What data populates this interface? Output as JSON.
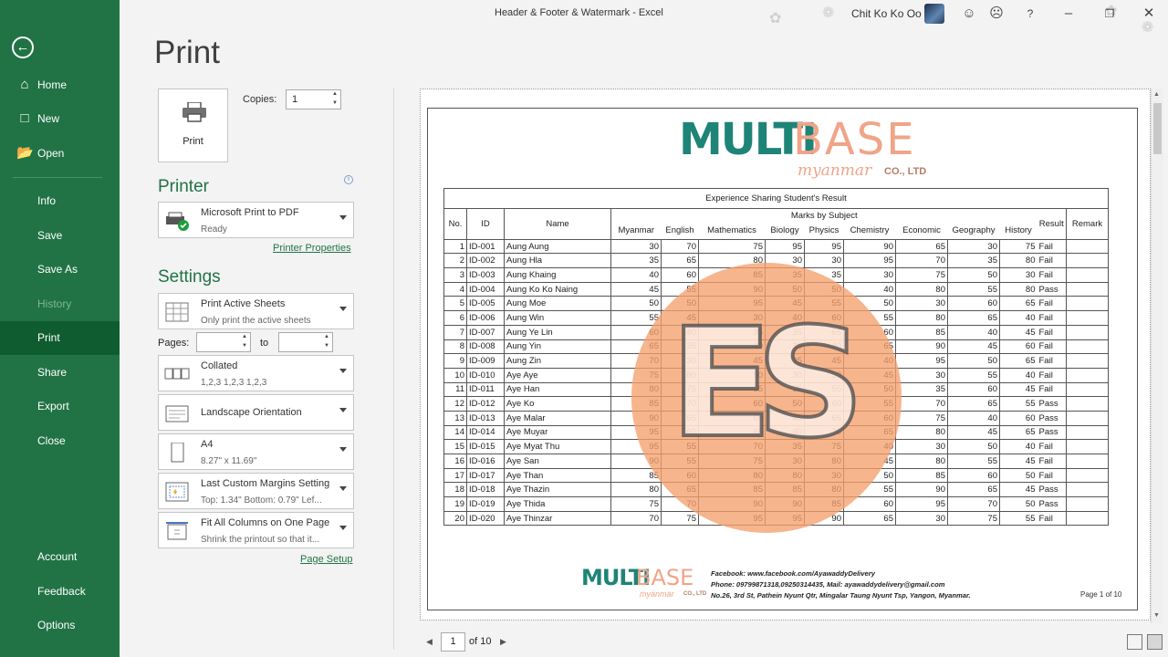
{
  "window": {
    "title": "Header & Footer & Watermark  -  Excel",
    "user": "Chit Ko Ko Oo"
  },
  "sidebar": {
    "items": [
      {
        "label": "Home",
        "icon": "home-icon"
      },
      {
        "label": "New",
        "icon": "new-document-icon"
      },
      {
        "label": "Open",
        "icon": "open-folder-icon"
      },
      {
        "label": "Info"
      },
      {
        "label": "Save"
      },
      {
        "label": "Save As"
      },
      {
        "label": "History"
      },
      {
        "label": "Print"
      },
      {
        "label": "Share"
      },
      {
        "label": "Export"
      },
      {
        "label": "Close"
      },
      {
        "label": "Account"
      },
      {
        "label": "Feedback"
      },
      {
        "label": "Options"
      }
    ]
  },
  "print": {
    "heading": "Print",
    "button_label": "Print",
    "copies_label": "Copies:",
    "copies_value": "1",
    "printer_heading": "Printer",
    "printer_name": "Microsoft Print to PDF",
    "printer_status": "Ready",
    "printer_properties": "Printer Properties",
    "settings_heading": "Settings",
    "sheets_l1": "Print Active Sheets",
    "sheets_l2": "Only print the active sheets",
    "pages_label": "Pages:",
    "to_label": "to",
    "collated_l1": "Collated",
    "collated_l2": "1,2,3    1,2,3    1,2,3",
    "orientation": "Landscape Orientation",
    "paper_l1": "A4",
    "paper_l2": "8.27\" x 11.69\"",
    "margins_l1": "Last Custom Margins Setting",
    "margins_l2": "Top: 1.34\" Bottom: 0.79\" Lef...",
    "scaling_l1": "Fit All Columns on One Page",
    "scaling_l2": "Shrink the printout so that it...",
    "page_setup": "Page Setup"
  },
  "preview": {
    "logo_multi": "MULTI",
    "logo_base": "BASE",
    "logo_myanmar": "myanmar",
    "logo_co": "CO., LTD",
    "table_title": "Experience Sharing Student's Result",
    "headers": {
      "no": "No.",
      "id": "ID",
      "name": "Name",
      "marks": "Marks by Subject",
      "result": "Result",
      "remark": "Remark"
    },
    "subjects": [
      "Myanmar",
      "English",
      "Mathematics",
      "Biology",
      "Physics",
      "Chemistry",
      "Economic",
      "Geography",
      "History"
    ],
    "rows": [
      [
        "1",
        "ID-001",
        "Aung Aung",
        "30",
        "70",
        "75",
        "95",
        "95",
        "90",
        "65",
        "30",
        "75",
        "Fail"
      ],
      [
        "2",
        "ID-002",
        "Aung Hla",
        "35",
        "65",
        "80",
        "30",
        "30",
        "95",
        "70",
        "35",
        "80",
        "Fail"
      ],
      [
        "3",
        "ID-003",
        "Aung Khaing",
        "40",
        "60",
        "85",
        "35",
        "35",
        "30",
        "75",
        "50",
        "30",
        "Fail"
      ],
      [
        "4",
        "ID-004",
        "Aung Ko Ko Naing",
        "45",
        "55",
        "90",
        "50",
        "50",
        "40",
        "80",
        "55",
        "80",
        "Pass"
      ],
      [
        "5",
        "ID-005",
        "Aung Moe",
        "50",
        "50",
        "95",
        "45",
        "55",
        "50",
        "30",
        "60",
        "65",
        "Fail"
      ],
      [
        "6",
        "ID-006",
        "Aung Win",
        "55",
        "45",
        "30",
        "40",
        "60",
        "55",
        "80",
        "65",
        "40",
        "Fail"
      ],
      [
        "7",
        "ID-007",
        "Aung Ye Lin",
        "60",
        "40",
        "35",
        "35",
        "65",
        "60",
        "85",
        "40",
        "45",
        "Fail"
      ],
      [
        "8",
        "ID-008",
        "Aung Yin",
        "65",
        "35",
        "40",
        "30",
        "40",
        "65",
        "90",
        "45",
        "60",
        "Fail"
      ],
      [
        "9",
        "ID-009",
        "Aung Zin",
        "70",
        "30",
        "45",
        "95",
        "45",
        "40",
        "95",
        "50",
        "65",
        "Fail"
      ],
      [
        "10",
        "ID-010",
        "Aye Aye",
        "75",
        "80",
        "50",
        "30",
        "50",
        "45",
        "30",
        "55",
        "40",
        "Fail"
      ],
      [
        "11",
        "ID-011",
        "Aye Han",
        "80",
        "75",
        "55",
        "35",
        "55",
        "50",
        "35",
        "60",
        "45",
        "Fail"
      ],
      [
        "12",
        "ID-012",
        "Aye Ko",
        "85",
        "70",
        "60",
        "50",
        "60",
        "55",
        "70",
        "65",
        "55",
        "Pass"
      ],
      [
        "13",
        "ID-013",
        "Aye Malar",
        "90",
        "65",
        "60",
        "45",
        "65",
        "60",
        "75",
        "40",
        "60",
        "Pass"
      ],
      [
        "14",
        "ID-014",
        "Aye Muyar",
        "95",
        "60",
        "65",
        "40",
        "70",
        "65",
        "80",
        "45",
        "65",
        "Pass"
      ],
      [
        "15",
        "ID-015",
        "Aye Myat Thu",
        "95",
        "55",
        "70",
        "35",
        "75",
        "40",
        "30",
        "50",
        "40",
        "Fail"
      ],
      [
        "16",
        "ID-016",
        "Aye San",
        "90",
        "55",
        "75",
        "30",
        "80",
        "45",
        "80",
        "55",
        "45",
        "Fail"
      ],
      [
        "17",
        "ID-017",
        "Aye Than",
        "85",
        "60",
        "80",
        "80",
        "30",
        "50",
        "85",
        "60",
        "50",
        "Fail"
      ],
      [
        "18",
        "ID-018",
        "Aye Thazin",
        "80",
        "65",
        "85",
        "85",
        "80",
        "55",
        "90",
        "65",
        "45",
        "Pass"
      ],
      [
        "19",
        "ID-019",
        "Aye Thida",
        "75",
        "70",
        "90",
        "90",
        "85",
        "60",
        "95",
        "70",
        "50",
        "Pass"
      ],
      [
        "20",
        "ID-020",
        "Aye Thinzar",
        "70",
        "75",
        "95",
        "95",
        "90",
        "65",
        "30",
        "75",
        "55",
        "Fail"
      ]
    ],
    "watermark": "ES",
    "footer": {
      "facebook": "Facebook: www.facebook.com/AyawaddyDelivery",
      "phone": "Phone: 09799871318,09250314435, Mail: ayawaddydelivery@gmail.com",
      "address": "No.26, 3rd St, Pathein Nyunt Qtr, Mingalar Taung Nyunt Tsp, Yangon, Myanmar.",
      "page": "Page 1 of 10"
    }
  },
  "pager": {
    "current": "1",
    "total_label": "of 10"
  },
  "colors": {
    "sidebar": "#217346",
    "sidebar_active": "#0e5c2f",
    "accent": "#217346",
    "logo_teal": "#1e8477",
    "logo_peach": "#f0a488",
    "watermark": "#f5a06e"
  }
}
